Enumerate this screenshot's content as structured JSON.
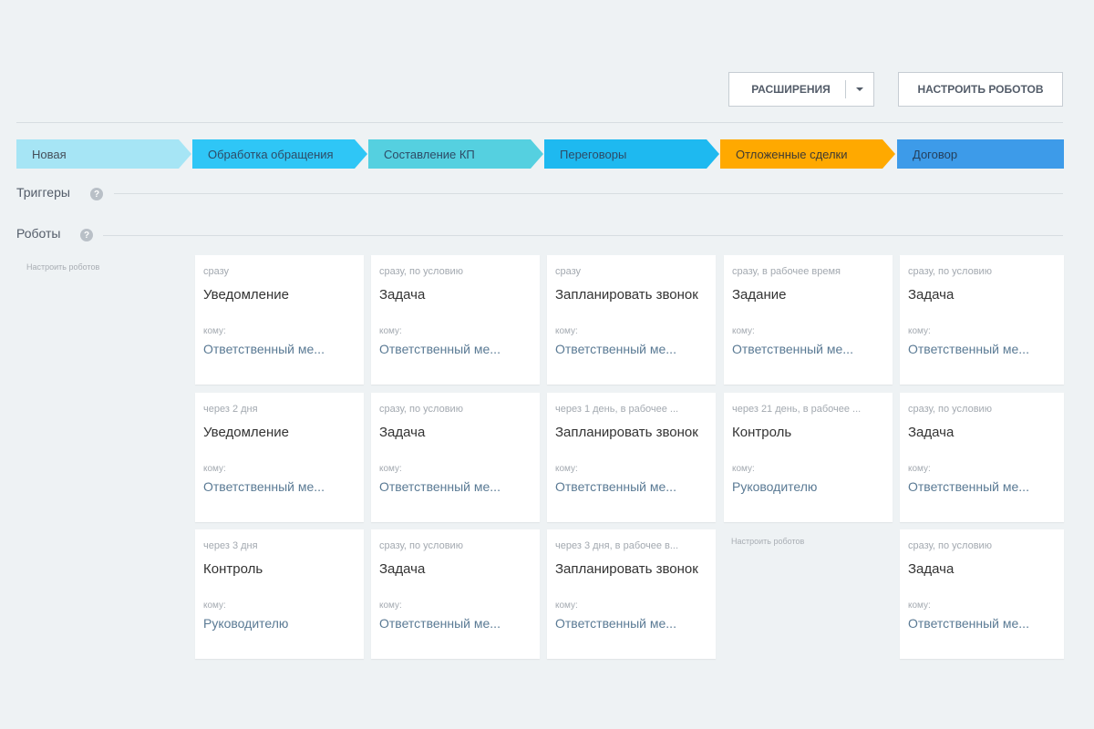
{
  "toolbar": {
    "extensions_label": "Расширения",
    "configure_robots_label": "Настроить роботов"
  },
  "stages": [
    {
      "label": "Новая",
      "color": "#a6e5f5",
      "text_color": "#454f5a"
    },
    {
      "label": "Обработка обращения",
      "color": "#2fc6f6",
      "text_color": "#2d4b66"
    },
    {
      "label": "Составление КП",
      "color": "#55d0e0",
      "text_color": "#2d4b66"
    },
    {
      "label": "Переговоры",
      "color": "#1eb9f0",
      "text_color": "#2d4b66"
    },
    {
      "label": "Отложенные сделки",
      "color": "#ffa900",
      "text_color": "#3e3a33"
    },
    {
      "label": "Договор",
      "color": "#3d9be9",
      "text_color": "#243f5c"
    }
  ],
  "sections": {
    "triggers_label": "Триггеры",
    "robots_label": "Роботы",
    "help_glyph": "?"
  },
  "setup_link": "Настроить роботов",
  "robot_columns": [
    {
      "cards": [
        {
          "when": "сразу",
          "title": "Уведомление",
          "to_label": "кому:",
          "to": "Ответственный ме..."
        },
        {
          "when": "через 2 дня",
          "title": "Уведомление",
          "to_label": "кому:",
          "to": "Ответственный ме..."
        },
        {
          "when": "через 3 дня",
          "title": "Контроль",
          "to_label": "кому:",
          "to": "Руководителю"
        }
      ]
    },
    {
      "cards": [
        {
          "when": "сразу, по условию",
          "title": "Задача",
          "to_label": "кому:",
          "to": "Ответственный ме..."
        },
        {
          "when": "сразу, по условию",
          "title": "Задача",
          "to_label": "кому:",
          "to": "Ответственный ме..."
        },
        {
          "when": "сразу, по условию",
          "title": "Задача",
          "to_label": "кому:",
          "to": "Ответственный ме..."
        }
      ]
    },
    {
      "cards": [
        {
          "when": "сразу",
          "title": "Запланировать звонок",
          "to_label": "кому:",
          "to": "Ответственный ме..."
        },
        {
          "when": "через 1 день, в рабочее ...",
          "title": "Запланировать звонок",
          "to_label": "кому:",
          "to": "Ответственный ме..."
        },
        {
          "when": "через 3 дня, в рабочее в...",
          "title": "Запланировать звонок",
          "to_label": "кому:",
          "to": "Ответственный ме..."
        }
      ]
    },
    {
      "cards": [
        {
          "when": "сразу, в рабочее время",
          "title": "Задание",
          "to_label": "кому:",
          "to": "Ответственный ме..."
        },
        {
          "when": "через 21 день, в рабочее ...",
          "title": "Контроль",
          "to_label": "кому:",
          "to": "Руководителю"
        }
      ]
    },
    {
      "cards": [
        {
          "when": "сразу, по условию",
          "title": "Задача",
          "to_label": "кому:",
          "to": "Ответственный ме..."
        },
        {
          "when": "сразу, по условию",
          "title": "Задача",
          "to_label": "кому:",
          "to": "Ответственный ме..."
        },
        {
          "when": "сразу, по условию",
          "title": "Задача",
          "to_label": "кому:",
          "to": "Ответственный ме..."
        }
      ]
    }
  ]
}
